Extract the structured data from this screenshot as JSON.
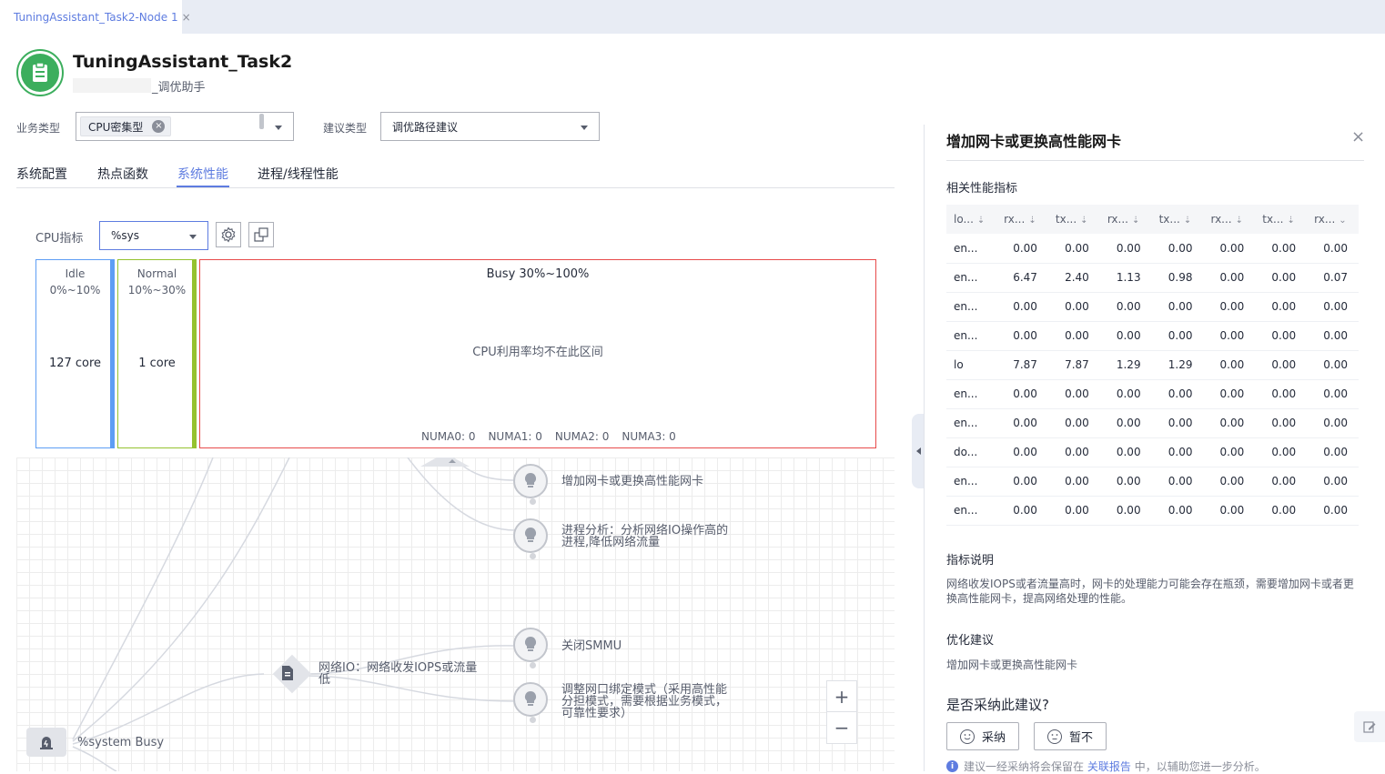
{
  "tab": {
    "label": "TuningAssistant_Task2-Node 1",
    "close": "×"
  },
  "header": {
    "title": "TuningAssistant_Task2",
    "subtitle": "_调优助手"
  },
  "filters": {
    "biz_type_label": "业务类型",
    "biz_type_chip": "CPU密集型",
    "suggest_type_label": "建议类型",
    "suggest_type_value": "调优路径建议"
  },
  "nav": {
    "tabs": [
      "系统配置",
      "热点函数",
      "系统性能",
      "进程/线程性能"
    ],
    "active": "系统性能"
  },
  "cpu": {
    "metric_label": "CPU指标",
    "metric_value": "%sys",
    "idle": {
      "name": "Idle",
      "range": "0%~10%",
      "count": "127 core"
    },
    "normal": {
      "name": "Normal",
      "range": "10%~30%",
      "count": "1 core"
    },
    "busy": {
      "name": "Busy 30%~100%",
      "message": "CPU利用率均不在此区间",
      "numa": [
        "NUMA0: 0",
        "NUMA1: 0",
        "NUMA2: 0",
        "NUMA3: 0"
      ]
    }
  },
  "flow": {
    "root": "%system Busy",
    "mid": "网络IO：网络收发IOPS或流量低",
    "leaves": [
      {
        "label": "增加网卡或更换高性能网卡"
      },
      {
        "label": "进程分析：分析网络IO操作高的进程,降低网络流量"
      },
      {
        "label": "关闭SMMU"
      },
      {
        "label": "调整网口绑定模式（采用高性能分担模式，需要根据业务模式，可靠性要求）"
      }
    ],
    "zoom_in": "+",
    "zoom_out": "−"
  },
  "panel": {
    "title": "增加网卡或更换高性能网卡",
    "close": "×",
    "metrics_title": "相关性能指标",
    "columns": [
      "lo...",
      "rx...",
      "tx...",
      "rx...",
      "tx...",
      "rx...",
      "tx...",
      "rx..."
    ],
    "rows": [
      [
        "en...",
        "0.00",
        "0.00",
        "0.00",
        "0.00",
        "0.00",
        "0.00",
        "0.00"
      ],
      [
        "en...",
        "6.47",
        "2.40",
        "1.13",
        "0.98",
        "0.00",
        "0.00",
        "0.07"
      ],
      [
        "en...",
        "0.00",
        "0.00",
        "0.00",
        "0.00",
        "0.00",
        "0.00",
        "0.00"
      ],
      [
        "en...",
        "0.00",
        "0.00",
        "0.00",
        "0.00",
        "0.00",
        "0.00",
        "0.00"
      ],
      [
        "lo",
        "7.87",
        "7.87",
        "1.29",
        "1.29",
        "0.00",
        "0.00",
        "0.00"
      ],
      [
        "en...",
        "0.00",
        "0.00",
        "0.00",
        "0.00",
        "0.00",
        "0.00",
        "0.00"
      ],
      [
        "en...",
        "0.00",
        "0.00",
        "0.00",
        "0.00",
        "0.00",
        "0.00",
        "0.00"
      ],
      [
        "do...",
        "0.00",
        "0.00",
        "0.00",
        "0.00",
        "0.00",
        "0.00",
        "0.00"
      ],
      [
        "en...",
        "0.00",
        "0.00",
        "0.00",
        "0.00",
        "0.00",
        "0.00",
        "0.00"
      ],
      [
        "en...",
        "0.00",
        "0.00",
        "0.00",
        "0.00",
        "0.00",
        "0.00",
        "0.00"
      ]
    ],
    "desc_title": "指标说明",
    "desc": "网络收发IOPS或者流量高时，网卡的处理能力可能会存在瓶颈，需要增加网卡或者更换高性能网卡，提高网络处理的性能。",
    "advice_title": "优化建议",
    "advice": "增加网卡或更换高性能网卡",
    "adopt_question": "是否采纳此建议?",
    "adopt": "采纳",
    "reject": "暂不",
    "note_prefix": "建议一经采纳将会保留在",
    "note_link": "关联报告",
    "note_suffix": "中，以辅助您进一步分析。"
  },
  "colors": {
    "accent": "#5e7ce0",
    "idle_bar": "#5e9ef4",
    "normal_bar": "#95c22f",
    "busy_border": "#e84a4a",
    "logo": "#3cae5d"
  }
}
